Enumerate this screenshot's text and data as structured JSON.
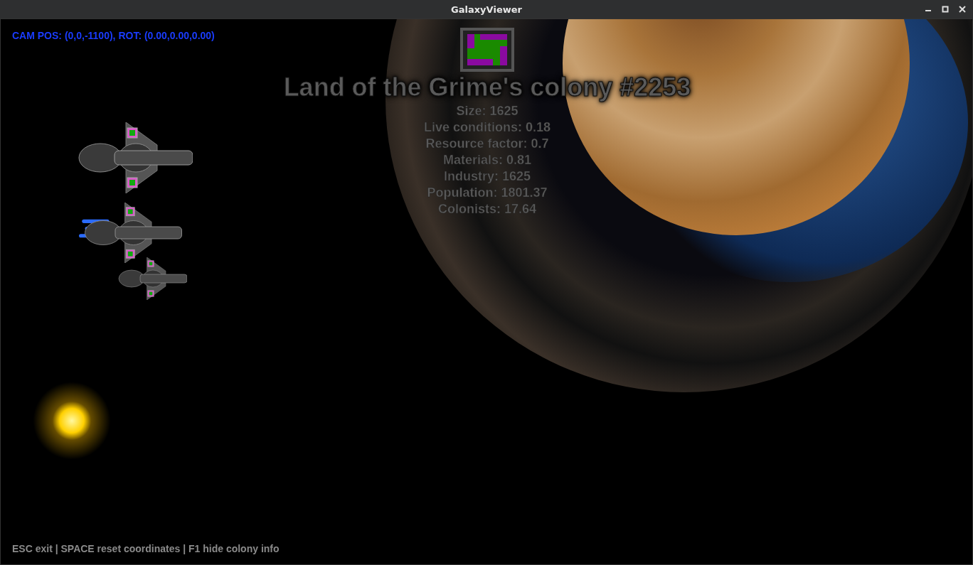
{
  "window": {
    "title": "GalaxyViewer"
  },
  "camera_info": "CAM POS: (0,0,-1100), ROT: (0.00,0.00,0.00)",
  "colony": {
    "name": "Land of the Grime's colony #2253",
    "stats": [
      "Size: 1625",
      "Live conditions: 0.18",
      "Resource factor: 0.7",
      "Materials: 0.81",
      "Industry: 1625",
      "Population: 1801.37",
      "Colonists: 17.64"
    ]
  },
  "help": "ESC exit | SPACE reset coordinates | F1 hide colony info"
}
